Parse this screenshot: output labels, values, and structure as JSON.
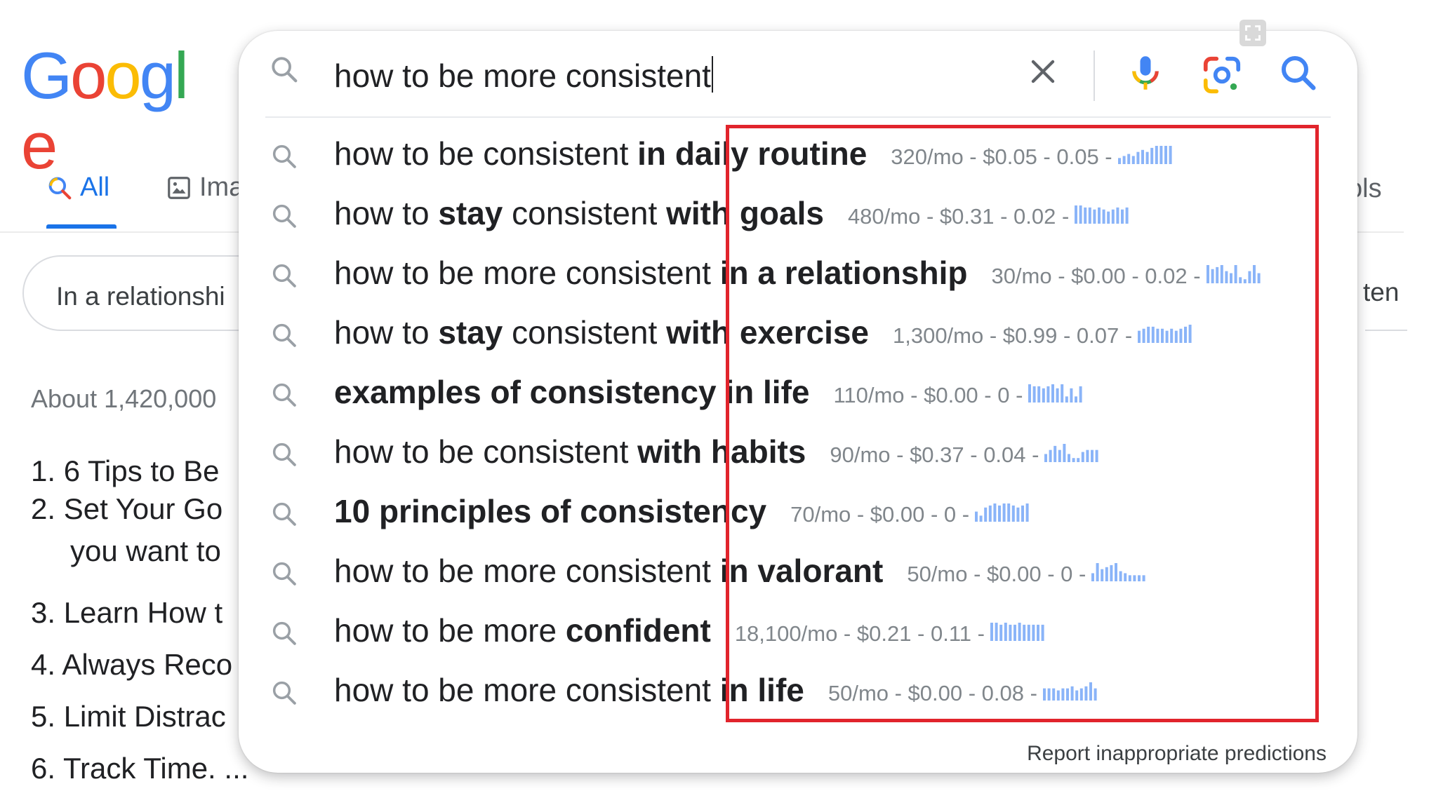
{
  "logo": {
    "text": "Google"
  },
  "search": {
    "query": "how to be more consistent",
    "clear_label": "✕"
  },
  "suggestions": [
    {
      "parts": [
        {
          "t": "how to be consistent ",
          "b": false
        },
        {
          "t": "in daily routine",
          "b": true
        }
      ],
      "metrics": "320/mo - $0.05 - 0.05 -",
      "trend": [
        3,
        4,
        5,
        4,
        6,
        7,
        6,
        8,
        9,
        9,
        9,
        9
      ]
    },
    {
      "parts": [
        {
          "t": "how to ",
          "b": false
        },
        {
          "t": "stay",
          "b": true
        },
        {
          "t": " consistent ",
          "b": false
        },
        {
          "t": "with goals",
          "b": true
        }
      ],
      "metrics": "480/mo - $0.31 - 0.02 -",
      "trend": [
        9,
        9,
        8,
        8,
        7,
        8,
        7,
        6,
        7,
        8,
        7,
        8
      ]
    },
    {
      "parts": [
        {
          "t": "how to be more consistent ",
          "b": false
        },
        {
          "t": "in a relationship",
          "b": true
        }
      ],
      "metrics": "30/mo - $0.00 - 0.02 -",
      "trend": [
        9,
        7,
        8,
        9,
        6,
        5,
        9,
        3,
        2,
        6,
        9,
        5
      ]
    },
    {
      "parts": [
        {
          "t": "how to ",
          "b": false
        },
        {
          "t": "stay",
          "b": true
        },
        {
          "t": " consistent ",
          "b": false
        },
        {
          "t": "with exercise",
          "b": true
        }
      ],
      "metrics": "1,300/mo - $0.99 - 0.07 -",
      "trend": [
        6,
        7,
        8,
        8,
        7,
        7,
        6,
        7,
        6,
        7,
        8,
        9
      ]
    },
    {
      "parts": [
        {
          "t": "examples of consistency in life",
          "b": true
        }
      ],
      "metrics": "110/mo - $0.00 - 0 -",
      "trend": [
        9,
        8,
        8,
        7,
        8,
        9,
        7,
        9,
        3,
        7,
        3,
        8
      ]
    },
    {
      "parts": [
        {
          "t": "how to be consistent ",
          "b": false
        },
        {
          "t": "with habits",
          "b": true
        }
      ],
      "metrics": "90/mo - $0.37 - 0.04 -",
      "trend": [
        4,
        6,
        8,
        6,
        9,
        4,
        2,
        2,
        5,
        6,
        6,
        6
      ]
    },
    {
      "parts": [
        {
          "t": "10 principles of consistency",
          "b": true
        }
      ],
      "metrics": "70/mo - $0.00 - 0 -",
      "trend": [
        5,
        3,
        7,
        8,
        9,
        8,
        9,
        9,
        8,
        7,
        8,
        9
      ]
    },
    {
      "parts": [
        {
          "t": "how to be more consistent ",
          "b": false
        },
        {
          "t": "in valorant",
          "b": true
        }
      ],
      "metrics": "50/mo - $0.00 - 0 -",
      "trend": [
        4,
        9,
        6,
        7,
        8,
        9,
        5,
        4,
        3,
        3,
        3,
        3
      ]
    },
    {
      "parts": [
        {
          "t": "how to be more ",
          "b": false
        },
        {
          "t": "confident",
          "b": true
        }
      ],
      "metrics": "18,100/mo - $0.21 - 0.11 -",
      "trend": [
        9,
        9,
        8,
        9,
        8,
        8,
        9,
        8,
        8,
        8,
        8,
        8
      ]
    },
    {
      "parts": [
        {
          "t": "how to be more consistent ",
          "b": false
        },
        {
          "t": "in life",
          "b": true
        }
      ],
      "metrics": "50/mo - $0.00 - 0.08 -",
      "trend": [
        6,
        6,
        6,
        5,
        6,
        6,
        7,
        5,
        6,
        7,
        9,
        6
      ]
    }
  ],
  "report_text": "Report inappropriate predictions",
  "background": {
    "tab_all": "All",
    "tab_images": "Ima",
    "tab_tools": "ols",
    "chip_text": "In a relationshi",
    "chip_right_text": "ten",
    "results_count": "About 1,420,000",
    "results": [
      "1. 6 Tips to Be",
      "2. Set Your Go",
      "you want to",
      "3. Learn How t",
      "4. Always Reco",
      "5. Limit Distrac",
      "6. Track Time. ..."
    ]
  },
  "colors": {
    "accent": "#1a73e8",
    "highlight": "#e1242c",
    "sparkline": "#8ab4f8",
    "metrics_text": "#80868b",
    "logo": [
      "#4285f4",
      "#ea4335",
      "#fbbc05",
      "#4285f4",
      "#34a853",
      "#ea4335"
    ]
  },
  "icons": {
    "search": "search-icon",
    "clear": "close-icon",
    "mic": "microphone-icon",
    "lens": "camera-lens-icon",
    "submit": "search-submit-icon",
    "images_tab": "image-icon",
    "fullscreen": "fullscreen-icon"
  }
}
